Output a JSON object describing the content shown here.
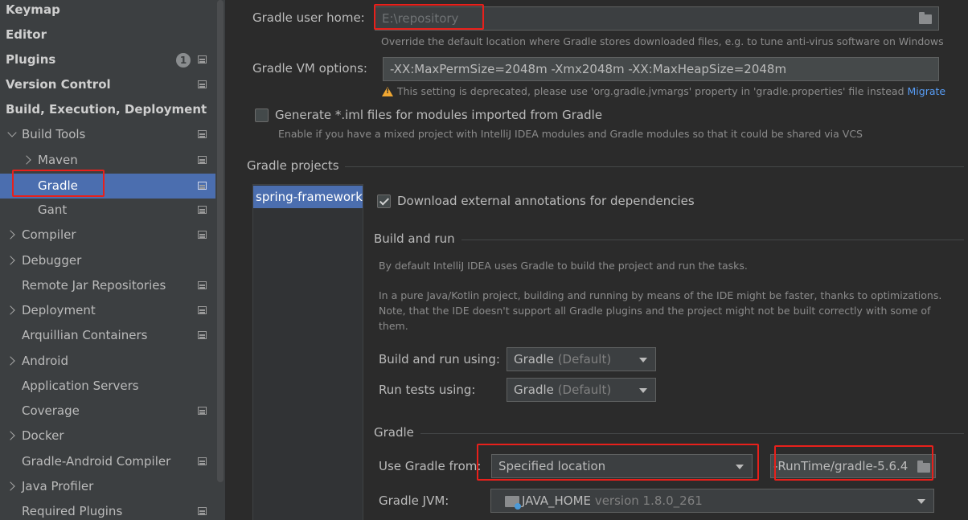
{
  "sidebar": {
    "top_items": [
      "Keymap",
      "Editor",
      "Plugins",
      "Version Control",
      "Build, Execution, Deployment"
    ],
    "plugins_badge": "1",
    "build_tools": "Build Tools",
    "maven": "Maven",
    "gradle": "Gradle",
    "gant": "Gant",
    "items": [
      "Compiler",
      "Debugger",
      "Remote Jar Repositories",
      "Deployment",
      "Arquillian Containers",
      "Android",
      "Application Servers",
      "Coverage",
      "Docker",
      "Gradle-Android Compiler",
      "Java Profiler",
      "Required Plugins"
    ]
  },
  "main": {
    "user_home_label": "Gradle user home:",
    "user_home_value": "E:\\repository",
    "user_home_hint": "Override the default location where Gradle stores downloaded files, e.g. to tune anti-virus software on Windows",
    "vm_options_label": "Gradle VM options:",
    "vm_options_value": "-XX:MaxPermSize=2048m -Xmx2048m -XX:MaxHeapSize=2048m",
    "vm_warning": "This setting is deprecated, please use 'org.gradle.jvmargs' property in 'gradle.properties' file instead",
    "migrate_link": "Migrate",
    "generate_iml_label": "Generate *.iml files for modules imported from Gradle",
    "generate_iml_checked": false,
    "generate_iml_hint": "Enable if you have a mixed project with IntelliJ IDEA modules and Gradle modules so that it could be shared via VCS",
    "gradle_projects_title": "Gradle projects",
    "project_name": "spring-framework",
    "download_annotations_label": "Download external annotations for dependencies",
    "download_annotations_checked": true,
    "build_run_title": "Build and run",
    "build_run_desc1": "By default IntelliJ IDEA uses Gradle to build the project and run the tasks.",
    "build_run_desc2_line1": "In a pure Java/Kotlin project, building and running by means of the IDE might be faster, thanks to optimizations.",
    "build_run_desc2_line2": "Note, that the IDE doesn't support all Gradle plugins and the project might not be built correctly with some of",
    "build_run_desc2_line3": "them.",
    "build_run_using_label": "Build and run using:",
    "build_run_using_value": "Gradle",
    "build_run_using_suffix": "(Default)",
    "run_tests_using_label": "Run tests using:",
    "run_tests_using_value": "Gradle",
    "run_tests_using_suffix": "(Default)",
    "gradle_title": "Gradle",
    "use_gradle_from_label": "Use Gradle from:",
    "use_gradle_from_value": "Specified location",
    "gradle_location_value": "-RunTime/gradle-5.6.4",
    "gradle_jvm_label": "Gradle JVM:",
    "gradle_jvm_value": "JAVA_HOME",
    "gradle_jvm_version": "version 1.8.0_261"
  },
  "colors": {
    "selection": "#4b6eaf",
    "highlight_box": "#e8201b",
    "link": "#589df6",
    "warning": "#f0a732"
  }
}
